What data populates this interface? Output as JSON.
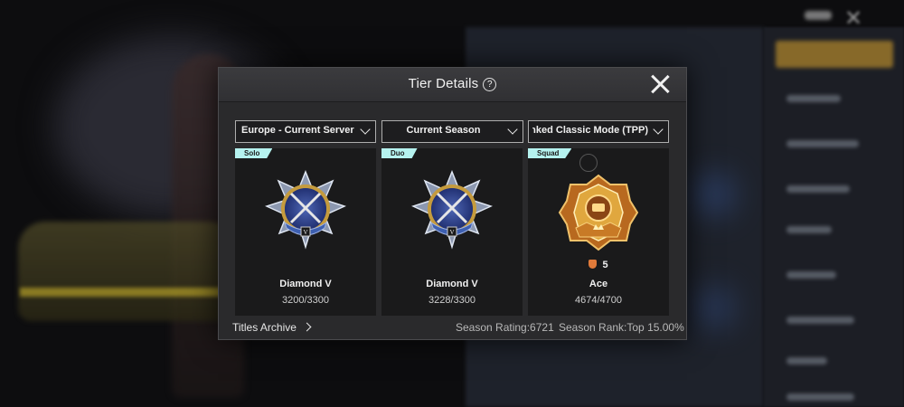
{
  "modal": {
    "title": "Tier Details",
    "help_icon": "?",
    "filters": {
      "server": "Europe - Current Server",
      "season": "Current Season",
      "mode": "Ranked Classic Mode (TPP)"
    },
    "cards": [
      {
        "mode": "Solo",
        "tier": "Diamond V",
        "points": "3200/3300",
        "emblem": "diamond-emblem"
      },
      {
        "mode": "Duo",
        "tier": "Diamond V",
        "points": "3228/3300",
        "emblem": "diamond-emblem"
      },
      {
        "mode": "Squad",
        "tier": "Ace",
        "level": "5",
        "points": "4674/4700",
        "emblem": "ace-emblem"
      }
    ],
    "footer": {
      "titles_archive": "Titles Archive",
      "season_rating": "Season Rating:6721",
      "season_rank": "Season Rank:Top 15.00%"
    }
  },
  "colors": {
    "mode_tag": "#b5f2ef",
    "diamond_blue": "#3b5ea8",
    "ace_gold": "#d08a2c"
  }
}
